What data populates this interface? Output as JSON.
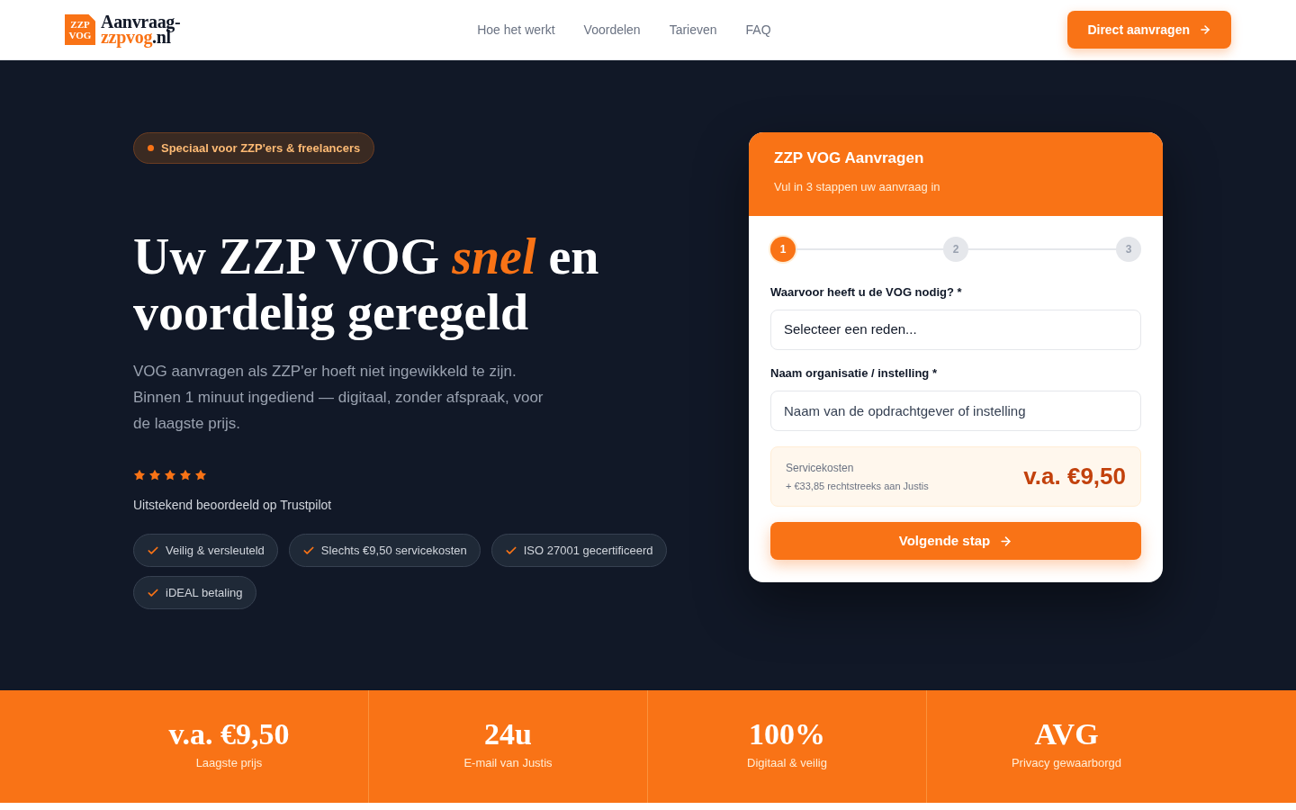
{
  "header": {
    "logo": {
      "mark": "ZZP VOG",
      "name_top": "Aanvraag-",
      "name_accent": "zzpvog",
      "name_tld": ".nl"
    },
    "nav": [
      "Hoe het werkt",
      "Voordelen",
      "Tarieven",
      "FAQ"
    ],
    "cta": "Direct aanvragen"
  },
  "hero": {
    "badge": "Speciaal voor ZZP'ers & freelancers",
    "heading": "Uw ZZP VOG *snel* en voordelig geregeld",
    "intro": "VOG aanvragen als ZZP'er hoeft niet ingewikkeld te zijn. Binnen 1 minuut ingediend — digitaal, zonder afspraak, voor de laagste prijs.",
    "rating": {
      "stars": 5,
      "text": "Uitstekend beoordeeld op Trustpilot"
    },
    "features": [
      "Veilig & versleuteld",
      "Slechts €9,50 servicekosten",
      "ISO 27001 gecertificeerd",
      "iDEAL betaling"
    ]
  },
  "form_card": {
    "title": "ZZP VOG Aanvragen",
    "subtitle": "Vul in 3 stappen uw aanvraag in",
    "steps": [
      {
        "label": "1",
        "selected": true
      },
      {
        "label": "2",
        "selected": false
      },
      {
        "label": "3",
        "selected": false
      }
    ],
    "fields": [
      {
        "kind": "select",
        "label": "Waarvoor heeft u de VOG nodig? *",
        "value": "Selecteer een reden..."
      },
      {
        "kind": "text",
        "label": "Naam organisatie / instelling *",
        "placeholder": "Naam van de opdrachtgever of instelling"
      }
    ],
    "price": {
      "label": "Servicekosten",
      "note": "+ €33,85 rechtstreeks aan Justis",
      "amount": "v.a. €9,50"
    },
    "submit": "Volgende stap"
  },
  "stats": [
    {
      "value": "v.a. €9,50",
      "label": "Laagste prijs"
    },
    {
      "value": "24u",
      "label": "E-mail van Justis"
    },
    {
      "value": "100%",
      "label": "Digitaal & veilig"
    },
    {
      "value": "AVG",
      "label": "Privacy gewaarborgd"
    }
  ]
}
